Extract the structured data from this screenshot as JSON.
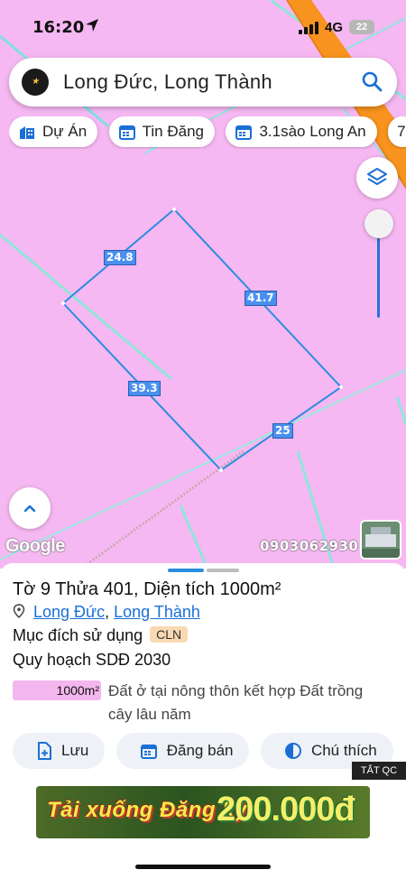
{
  "status_bar": {
    "time": "16:20",
    "network": "4G",
    "battery": "22"
  },
  "search": {
    "text": "Long Đức, Long Thành"
  },
  "chips": [
    {
      "label": "Dự Án",
      "icon": "building-icon"
    },
    {
      "label": "Tin Đăng",
      "icon": "calendar-icon"
    },
    {
      "label": "3.1sào Long An",
      "icon": "calendar-icon"
    },
    {
      "label": "7",
      "icon": ""
    }
  ],
  "map": {
    "parcel_edges": [
      "24.8",
      "41.7",
      "39.3",
      "25"
    ],
    "attribution": "Google",
    "phone": "0903062930",
    "colors": {
      "land": "#f6b8f2",
      "road": "#f7931e",
      "parcel": "#2b8de0"
    }
  },
  "parcel": {
    "title": "Tờ 9 Thửa 401, Diện tích 1000m²",
    "ward": "Long Đức",
    "district": "Long Thành",
    "separator": ",",
    "purpose_label": "Mục đích sử dụng",
    "purpose_code": "CLN",
    "plan_label": "Quy hoạch SDĐ 2030",
    "plan_area": "1000m²",
    "plan_description": "Đất ở tại nông thôn kết hợp Đất trồng cây lâu năm"
  },
  "actions": [
    {
      "label": "Lưu",
      "icon": "add-file-icon"
    },
    {
      "label": "Đăng bán",
      "icon": "calendar-icon"
    },
    {
      "label": "Chú thích",
      "icon": "contrast-icon"
    }
  ],
  "ad": {
    "close_label": "TẮT QC",
    "text_left": "Tải xuống Đăng ký",
    "text_right": "200.000đ"
  }
}
